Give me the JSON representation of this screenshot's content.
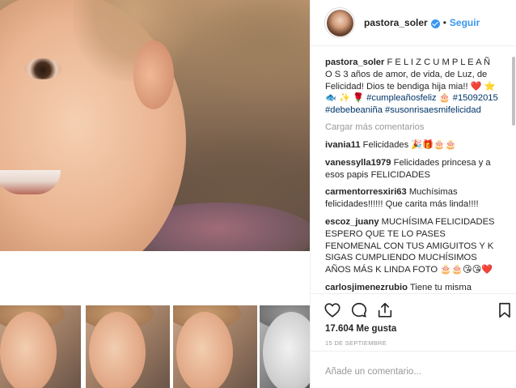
{
  "post": {
    "username": "pastora_soler",
    "separator": "•",
    "follow_label": "Seguir"
  },
  "caption": {
    "username": "pastora_soler",
    "text": "F E L I Z C U M P L E A Ñ O S 3 años de amor, de vida, de Luz, de Felicidad! Dios te bendiga hija mia!! ❤️ ⭐ 🐟 ✨ 🌹 ",
    "hashtags": [
      "#cumpleañosfeliz",
      "#15092015",
      "#debebeaniña",
      "#susonrisaesmifelicidad"
    ],
    "trailing_emoji": "🎂"
  },
  "load_more_label": "Cargar más comentarios",
  "comments": [
    {
      "user": "ivania11",
      "text": "Felicidades 🎉🎁🎂🎂"
    },
    {
      "user": "vanessylla1979",
      "text": "Felicidades princesa y a esos papis FELICIDADES"
    },
    {
      "user": "carmentorresxiri63",
      "text": "Muchísimas felicidades!!!!!! Que carita más linda!!!!"
    },
    {
      "user": "escoz_juany",
      "text": "MUCHÍSIMA FELICIDADES ESPERO QUE TE LO PASES FENOMENAL CON TUS AMIGUITOS Y K SIGAS CUMPLIENDO MUCHÍSIMOS AÑOS MÁS K LINDA FOTO 🎂🎂😘😘❤️"
    },
    {
      "user": "carlosjimenezrubio",
      "text": "Tiene tu misma"
    }
  ],
  "likes_label": "17.604 Me gusta",
  "date_label": "15 DE SEPTIEMBRE",
  "add_comment_placeholder": "Añade un comentario...",
  "icons": {
    "like": "heart-icon",
    "comment": "comment-icon",
    "share": "share-icon",
    "save": "bookmark-icon",
    "verified": "verified-badge-icon"
  },
  "colors": {
    "link_blue": "#3897f0",
    "hashtag_blue": "#003569",
    "muted_gray": "#999999",
    "text_dark": "#262626"
  }
}
